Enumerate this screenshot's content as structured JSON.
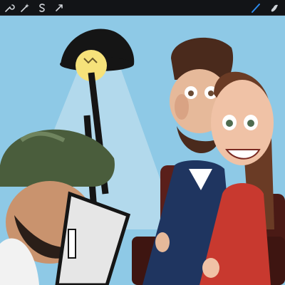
{
  "app": {
    "toolbar": {
      "left_tools": [
        {
          "icon": "wrench-icon"
        },
        {
          "icon": "magic-wand-icon"
        },
        {
          "icon": "selection-s-icon"
        },
        {
          "icon": "arrow-cursor-icon"
        }
      ],
      "right_tools": [
        {
          "icon": "brush-icon",
          "active": true,
          "active_color": "#2d8cf0"
        },
        {
          "icon": "smudge-icon",
          "active": false
        }
      ]
    },
    "canvas": {
      "artwork": "caricature-illustration",
      "colors": {
        "sky": "#8ec9e6",
        "lamp": "#151515",
        "bulb_glow": "#f6e27a",
        "red_dress": "#c8392f",
        "navy_suit": "#1f3560",
        "chair": "#5a1f1a",
        "beanie": "#4a5d3c"
      }
    }
  }
}
